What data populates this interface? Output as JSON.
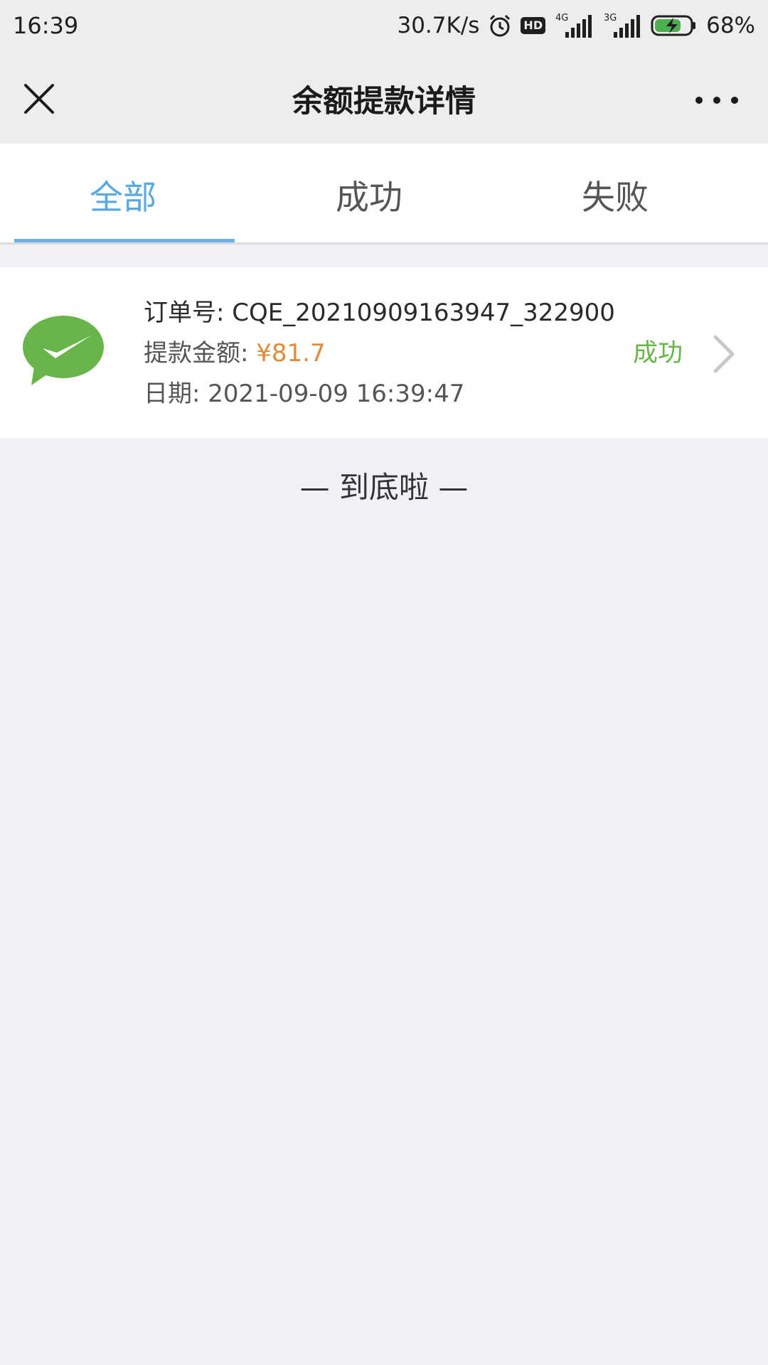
{
  "status_bar": {
    "time": "16:39",
    "net_speed": "30.7K/s",
    "hd_label": "HD",
    "sig1_label": "4G",
    "sig2_label": "3G",
    "battery": "68%"
  },
  "nav": {
    "title": "余额提款详情"
  },
  "tabs": [
    {
      "label": "全部",
      "active": true
    },
    {
      "label": "成功",
      "active": false
    },
    {
      "label": "失败",
      "active": false
    }
  ],
  "records": [
    {
      "order_label": "订单号: ",
      "order_no": "CQE_20210909163947_322900",
      "amount_label": "提款金额: ",
      "amount": "¥81.7",
      "date_label": "日期: ",
      "date": "2021-09-09 16:39:47",
      "status": "成功",
      "icon": "wechat-pay-icon"
    }
  ],
  "footer": {
    "end_text": "— 到底啦 —"
  },
  "colors": {
    "accent_blue": "#5aa9e0",
    "success_green": "#6ab54a",
    "amount_orange": "#e08a3a",
    "wechat_green": "#6ab54a"
  }
}
